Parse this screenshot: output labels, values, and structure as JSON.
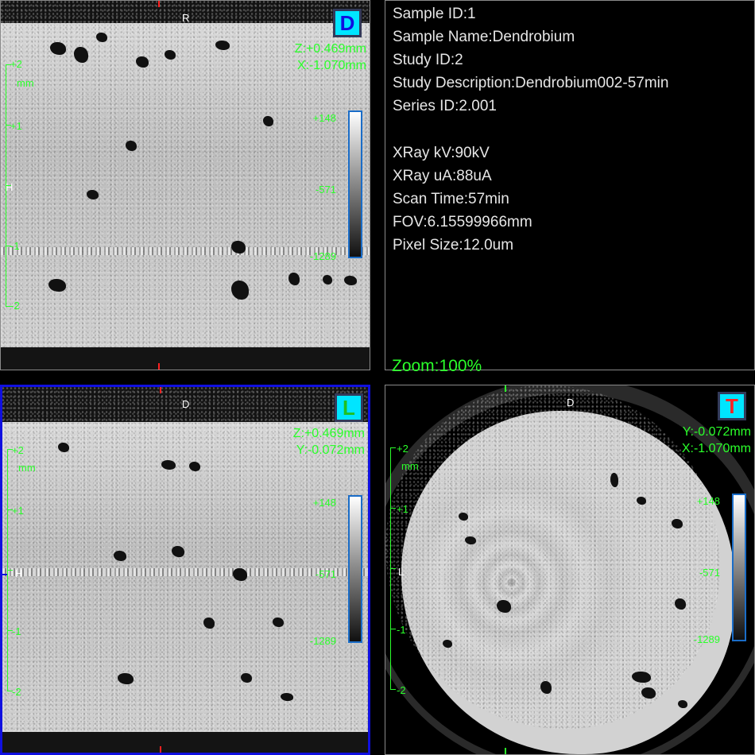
{
  "colors": {
    "accent": "#00e5ff",
    "overlay_green": "#2aff2a",
    "active_border": "#1010e0",
    "marker_red": "#ff2020"
  },
  "views": {
    "top_left": {
      "badge": "D",
      "badge_color": "#1010e0",
      "orient_top": "R",
      "orient_left": "H",
      "coord1": "Z:+0.469mm",
      "coord2": "X:-1.070mm",
      "cb_max": "+148",
      "cb_mid": "-571",
      "cb_min": "-1289",
      "ruler": [
        "+2",
        "mm",
        "+1",
        "-1",
        "-2"
      ]
    },
    "bottom_left": {
      "badge": "L",
      "badge_color": "#20c020",
      "orient_top": "D",
      "orient_left": "H",
      "coord1": "Z:+0.469mm",
      "coord2": "Y:-0.072mm",
      "cb_max": "+148",
      "cb_mid": "-571",
      "cb_min": "-1289",
      "ruler": [
        "+2",
        "mm",
        "+1",
        "-1",
        "-2"
      ]
    },
    "bottom_right": {
      "badge": "T",
      "badge_color": "#ff2020",
      "orient_top": "D",
      "orient_left": "L",
      "coord1": "Y:-0.072mm",
      "coord2": "X:-1.070mm",
      "cb_max": "+148",
      "cb_mid": "-571",
      "cb_min": "-1289",
      "ruler": [
        "+2",
        "mm",
        "+1",
        "-1",
        "-2"
      ]
    }
  },
  "info": {
    "lines": [
      "Sample ID:1",
      "Sample Name:Dendrobium",
      "Study ID:2",
      "Study Description:Dendrobium002-57min",
      "Series ID:2.001",
      "",
      "XRay kV:90kV",
      "XRay uA:88uA",
      "Scan Time:57min",
      "FOV:6.15599966mm",
      "Pixel Size:12.0um"
    ],
    "zoom": "Zoom:100%"
  }
}
